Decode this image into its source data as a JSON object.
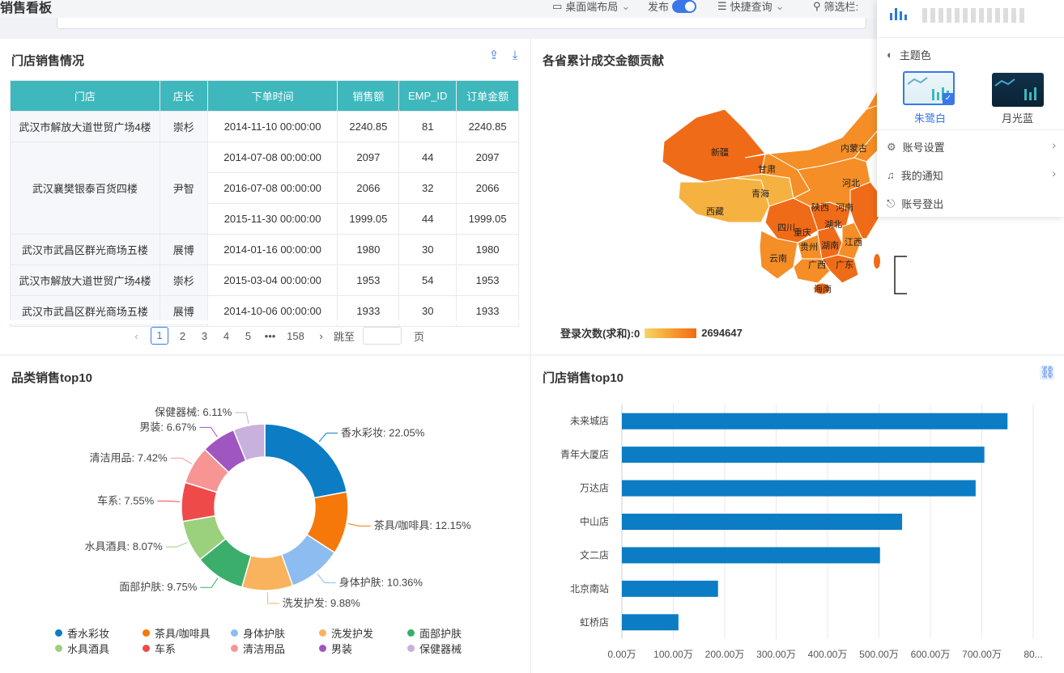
{
  "header": {
    "title": "销售看板",
    "layout_label": "桌面端布局",
    "publish_label": "发布",
    "quick_query_label": "快捷查询",
    "filter_label": "筛选栏:"
  },
  "store_table": {
    "title": "门店销售情况",
    "columns": [
      "门店",
      "店长",
      "下单时间",
      "销售额",
      "EMP_ID",
      "订单金额"
    ],
    "rows": [
      {
        "store": "武汉市解放大道世贸广场4楼",
        "manager": "崇杉",
        "time": "2014-11-10 00:00:00",
        "sales": "2240.85",
        "emp": "81",
        "amount": "2240.85"
      },
      {
        "store": "武汉襄樊银泰百货四楼",
        "manager": "尹智",
        "time": "2014-07-08 00:00:00",
        "sales": "2097",
        "emp": "44",
        "amount": "2097"
      },
      {
        "store": "",
        "manager": "",
        "time": "2016-07-08 00:00:00",
        "sales": "2066",
        "emp": "32",
        "amount": "2066"
      },
      {
        "store": "",
        "manager": "",
        "time": "2015-11-30 00:00:00",
        "sales": "1999.05",
        "emp": "44",
        "amount": "1999.05"
      },
      {
        "store": "武汉市武昌区群光商场五楼",
        "manager": "展博",
        "time": "2014-01-16 00:00:00",
        "sales": "1980",
        "emp": "30",
        "amount": "1980"
      },
      {
        "store": "武汉市解放大道世贸广场4楼",
        "manager": "崇杉",
        "time": "2015-03-04 00:00:00",
        "sales": "1953",
        "emp": "54",
        "amount": "1953"
      },
      {
        "store": "武汉市武昌区群光商场五楼",
        "manager": "展博",
        "time": "2014-10-06 00:00:00",
        "sales": "1933",
        "emp": "30",
        "amount": "1933"
      }
    ],
    "pager": {
      "prev": "‹",
      "current": "1",
      "pages": [
        "2",
        "3",
        "4",
        "5"
      ],
      "ellipsis": "•••",
      "last": "158",
      "next": "›",
      "goto_label": "跳至",
      "page_suffix": "页"
    }
  },
  "map": {
    "title": "各省累计成交金额贡献",
    "legend_label": "登录次数(求和):0",
    "legend_max": "2694647",
    "provinces": [
      "新疆",
      "西藏",
      "青海",
      "甘肃",
      "内蒙古",
      "四川",
      "云南",
      "贵州",
      "广西",
      "广东",
      "湖南",
      "湖北",
      "江西",
      "河南",
      "河北",
      "陕西",
      "重庆",
      "海南"
    ]
  },
  "category_chart": {
    "title": "品类销售top10",
    "chart_data": {
      "type": "pie",
      "title": "品类销售top10",
      "series": [
        {
          "name": "香水彩妆",
          "value": 22.05,
          "label": "香水彩妆: 22.05%",
          "color": "#0c7cc4"
        },
        {
          "name": "茶具/咖啡具",
          "value": 12.15,
          "label": "茶具/咖啡具: 12.15%",
          "color": "#f57808"
        },
        {
          "name": "身体护肤",
          "value": 10.36,
          "label": "身体护肤: 10.36%",
          "color": "#8cbcf0"
        },
        {
          "name": "洗发护发",
          "value": 9.88,
          "label": "洗发护发: 9.88%",
          "color": "#f9b35e"
        },
        {
          "name": "面部护肤",
          "value": 9.75,
          "label": "面部护肤: 9.75%",
          "color": "#3bae6c"
        },
        {
          "name": "水具酒具",
          "value": 8.07,
          "label": "水具酒具: 8.07%",
          "color": "#9bd07c"
        },
        {
          "name": "车系",
          "value": 7.55,
          "label": "车系: 7.55%",
          "color": "#ee4a4a"
        },
        {
          "name": "清洁用品",
          "value": 7.42,
          "label": "清洁用品: 7.42%",
          "color": "#f79595"
        },
        {
          "name": "男装",
          "value": 6.67,
          "label": "男装: 6.67%",
          "color": "#9f56c0"
        },
        {
          "name": "保健器械",
          "value": 6.11,
          "label": "保健器械: 6.11%",
          "color": "#c8b1dc"
        }
      ]
    }
  },
  "store_top10": {
    "title": "门店销售top10",
    "chart_data": {
      "type": "bar",
      "orientation": "horizontal",
      "categories": [
        "未来城店",
        "青年大厦店",
        "万达店",
        "中山店",
        "文二店",
        "北京南站",
        "虹桥店"
      ],
      "values": [
        7500000,
        7050000,
        6880000,
        5450000,
        5020000,
        1870000,
        1100000
      ],
      "xlim": [
        0,
        8000000
      ],
      "xticks": [
        "0.00万",
        "100.00万",
        "200.00万",
        "300.00万",
        "400.00万",
        "500.00万",
        "600.00万",
        "700.00万",
        "80..."
      ],
      "color": "#0c7cc4",
      "grid": true
    }
  },
  "popup": {
    "theme_label": "主题色",
    "themes": [
      {
        "name": "朱鹭白",
        "selected": true
      },
      {
        "name": "月光蓝",
        "selected": false
      }
    ],
    "items": [
      {
        "label": "账号设置",
        "has_arrow": true
      },
      {
        "label": "我的通知",
        "has_arrow": true
      },
      {
        "label": "账号登出",
        "has_arrow": false
      }
    ]
  }
}
